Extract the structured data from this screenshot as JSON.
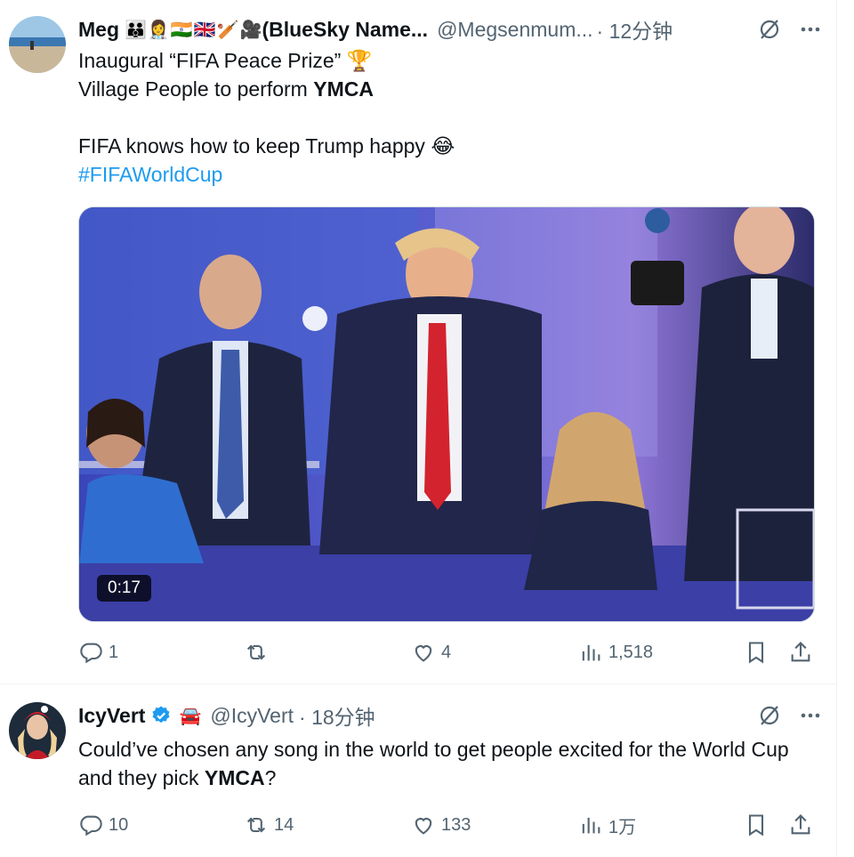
{
  "tweets": [
    {
      "name": "Meg",
      "name_suffix": "(BlueSky Name...",
      "name_emojis": [
        "👪",
        "👩‍⚕️",
        "🇮🇳",
        "🇬🇧",
        "🏏",
        "🎥"
      ],
      "handle": "@Megsenmum...",
      "time": "· 12分钟",
      "line1": "Inaugural “FIFA Peace Prize” ",
      "line1_emoji": "🏆",
      "line2_prefix": "Village People to perform ",
      "line2_bold": "YMCA",
      "line3": "FIFA knows how to keep Trump happy ",
      "line3_emoji": "😂",
      "hashtag": "#FIFAWorldCup",
      "video_duration": "0:17",
      "replies": "1",
      "reposts": "",
      "likes": "4",
      "views": "1,518"
    },
    {
      "name": "IcyVert",
      "badge_emoji": "🚘",
      "handle": "@IcyVert",
      "time": "· 18分钟",
      "text_prefix": "Could’ve chosen any song in the world to get people excited for the World Cup and they pick ",
      "text_bold": "YMCA",
      "text_suffix": "?",
      "replies": "10",
      "reposts": "14",
      "likes": "133",
      "views": "1万"
    }
  ],
  "colors": {
    "text": "#0f1419",
    "muted": "#536471",
    "link": "#1d9bf0",
    "verified": "#1d9bf0",
    "border": "#eff3f4"
  },
  "icons": [
    "reply-icon",
    "repost-icon",
    "like-icon",
    "views-icon",
    "bookmark-icon",
    "share-icon",
    "grok-icon",
    "more-icon",
    "verified-icon"
  ]
}
